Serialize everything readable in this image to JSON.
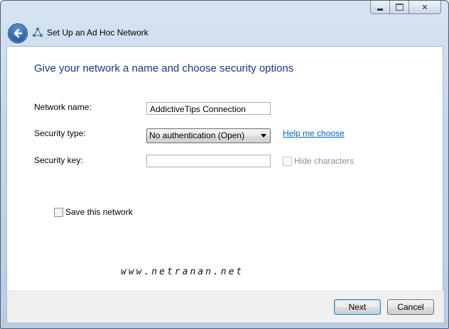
{
  "window": {
    "title": "Set Up an Ad Hoc Network",
    "caption": {
      "close_label": "✕"
    }
  },
  "form": {
    "heading": "Give your network a name and choose security options",
    "network_name": {
      "label": "Network name:",
      "value": "AddictiveTips Connection"
    },
    "security_type": {
      "label": "Security type:",
      "selected": "No authentication (Open)",
      "help_link": "Help me choose"
    },
    "security_key": {
      "label": "Security key:",
      "value": "",
      "hide_characters_label": "Hide characters",
      "hide_characters_checked": false
    },
    "save_network": {
      "label": "Save this network",
      "checked": false
    }
  },
  "watermark": "www.netranan.net",
  "buttons": {
    "next": "Next",
    "cancel": "Cancel"
  },
  "colors": {
    "heading": "#1e3287",
    "link": "#0066cc",
    "back_button": "#2f67ad"
  },
  "icons": [
    "back-arrow-icon",
    "ad-hoc-network-icon",
    "minimize-icon",
    "maximize-icon",
    "close-icon",
    "dropdown-arrow-icon"
  ]
}
